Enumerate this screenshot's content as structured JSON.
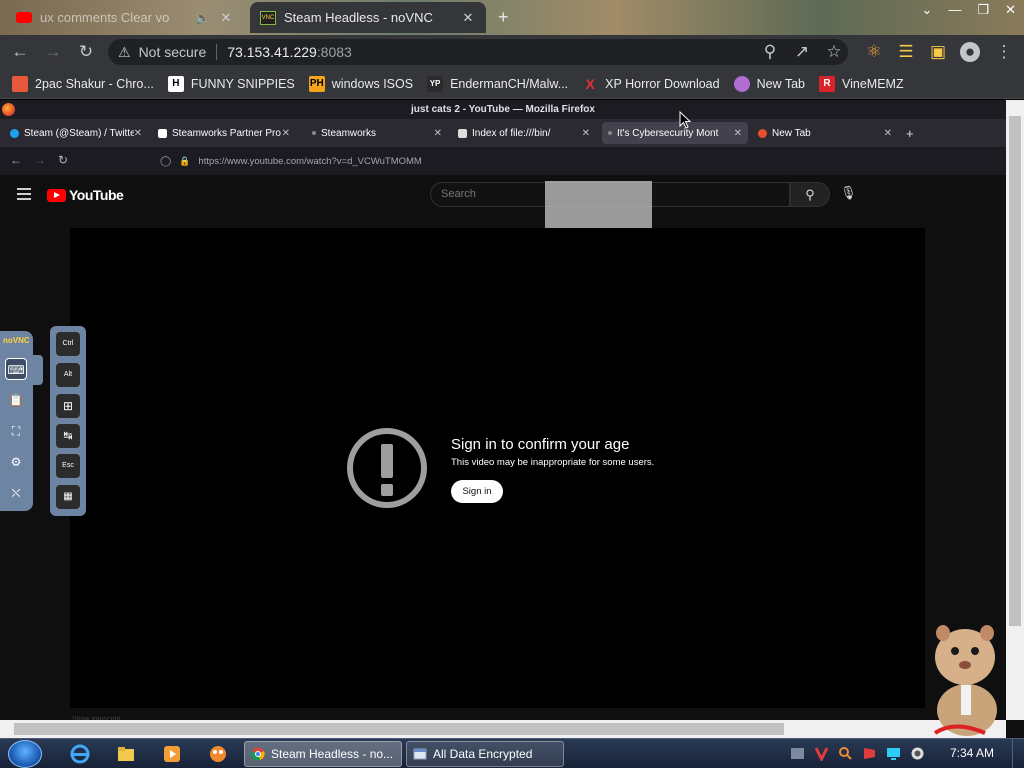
{
  "host": {
    "tabs": [
      {
        "title": "ux comments  Clear vo"
      },
      {
        "title": "Steam Headless - noVNC"
      }
    ],
    "omnibox": {
      "security_label": "Not secure",
      "host": "73.153.41.229",
      "port": ":8083"
    },
    "bookmarks": [
      {
        "label": "2pac Shakur - Chro...",
        "icon_color": "#e8593c",
        "glyph": ""
      },
      {
        "label": "FUNNY SNIPPIES",
        "icon_color": "#ffffff",
        "glyph": "H"
      },
      {
        "label": "windows ISOS",
        "icon_color": "#f7a41d",
        "glyph": "PH"
      },
      {
        "label": "EndermanCH/Malw...",
        "icon_color": "#2b2b2b",
        "glyph": "YP"
      },
      {
        "label": "XP Horror Download",
        "icon_color": "#e03232",
        "glyph": "X"
      },
      {
        "label": "New Tab",
        "icon_color": "#b06dd2",
        "glyph": ""
      },
      {
        "label": "VineMEMZ",
        "icon_color": "#d9242a",
        "glyph": "R"
      }
    ]
  },
  "firefox": {
    "window_title": "just cats 2 - YouTube — Mozilla Firefox",
    "tabs": [
      {
        "title": "Steam (@Steam) / Twitte",
        "icon_color": "#1da1f2"
      },
      {
        "title": "Steamworks Partner Pro",
        "icon_color": "#ffffff"
      },
      {
        "title": "Steamworks",
        "icon_color": "#888888"
      },
      {
        "title": "Index of file:///bin/",
        "icon_color": "#dddddd"
      },
      {
        "title": "It's Cybersecurity Mont",
        "icon_color": "#888888"
      },
      {
        "title": "New Tab",
        "icon_color": "#e5502a"
      }
    ],
    "url": "https://www.youtube.com/watch?v=d_VCWuTMOMM"
  },
  "youtube": {
    "logo_text": "YouTube",
    "search_placeholder": "Search",
    "age_gate": {
      "title": "Sign in to confirm your age",
      "subtitle": "This video may be inappropriate for some users.",
      "button": "Sign in"
    },
    "faint_text": "Show transcript"
  },
  "novnc": {
    "logo": "noVNC",
    "keys": [
      "Ctrl",
      "Alt",
      "Win",
      "Tab",
      "Esc",
      "C-A-D"
    ]
  },
  "taskbar": {
    "tasks": [
      "Steam Headless - no...",
      "All Data Encrypted"
    ],
    "clock": "7:34 AM"
  }
}
